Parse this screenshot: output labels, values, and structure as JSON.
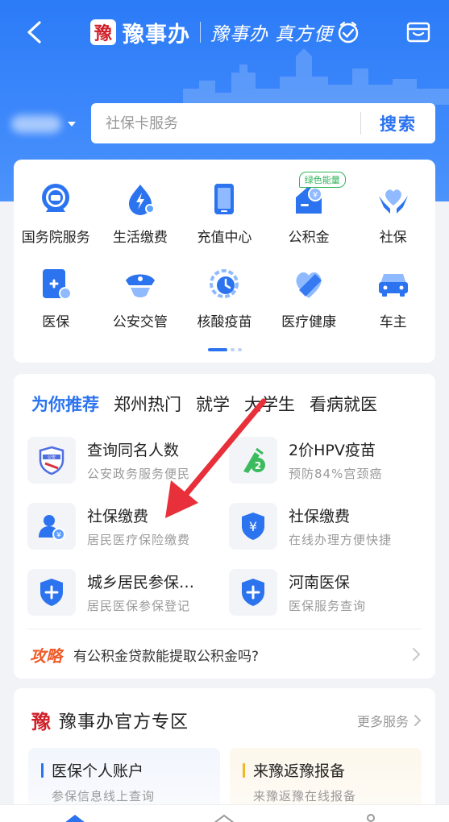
{
  "header": {
    "brand_logo": "豫",
    "brand_name": "豫事办",
    "slogan": "豫事办 真方便"
  },
  "search": {
    "placeholder": "社保卡服务",
    "button_label": "搜索"
  },
  "services": [
    {
      "label": "国务院服务",
      "icon": "state-council-icon"
    },
    {
      "label": "生活缴费",
      "icon": "utility-payment-icon"
    },
    {
      "label": "充值中心",
      "icon": "phone-recharge-icon"
    },
    {
      "label": "公积金",
      "icon": "housing-fund-icon",
      "badge": "绿色能量"
    },
    {
      "label": "社保",
      "icon": "social-security-icon"
    },
    {
      "label": "医保",
      "icon": "medical-insurance-icon"
    },
    {
      "label": "公安交管",
      "icon": "police-cap-icon"
    },
    {
      "label": "核酸疫苗",
      "icon": "nucleic-test-icon"
    },
    {
      "label": "医疗健康",
      "icon": "health-heart-icon"
    },
    {
      "label": "车主",
      "icon": "car-icon"
    }
  ],
  "recommend": {
    "tabs": [
      "为你推荐",
      "郑州热门",
      "就学",
      "大学生",
      "看病就医"
    ],
    "items": [
      {
        "title": "查询同名人数",
        "sub": "公安政务服务便民",
        "icon": "police-badge-icon"
      },
      {
        "title": "2价HPV疫苗",
        "sub": "预防84%宫颈癌",
        "icon": "hpv-vaccine-icon"
      },
      {
        "title": "社保缴费",
        "sub": "居民医疗保险缴费",
        "icon": "person-payment-icon"
      },
      {
        "title": "社保缴费",
        "sub": "在线办理方便快捷",
        "icon": "yuan-shield-icon"
      },
      {
        "title": "城乡居民参保…",
        "sub": "居民医保参保登记",
        "icon": "plus-shield-icon"
      },
      {
        "title": "河南医保",
        "sub": "医保服务查询",
        "icon": "plus-shield-icon"
      }
    ],
    "guide_tag": "攻略",
    "guide_text": "有公积金贷款能提取公积金吗?"
  },
  "official": {
    "logo": "豫",
    "title": "豫事办官方专区",
    "more": "更多服务",
    "cards": [
      {
        "title": "医保个人账户",
        "sub": "参保信息线上查询"
      },
      {
        "title": "来豫返豫报备",
        "sub": "来豫返豫在线报备"
      }
    ]
  },
  "colors": {
    "primary": "#2b73ef",
    "header_bg": "#2c7bf7",
    "guide_tag": "#f05a28",
    "badge_green": "#2fb45a",
    "annotation_red": "#e8303a"
  }
}
